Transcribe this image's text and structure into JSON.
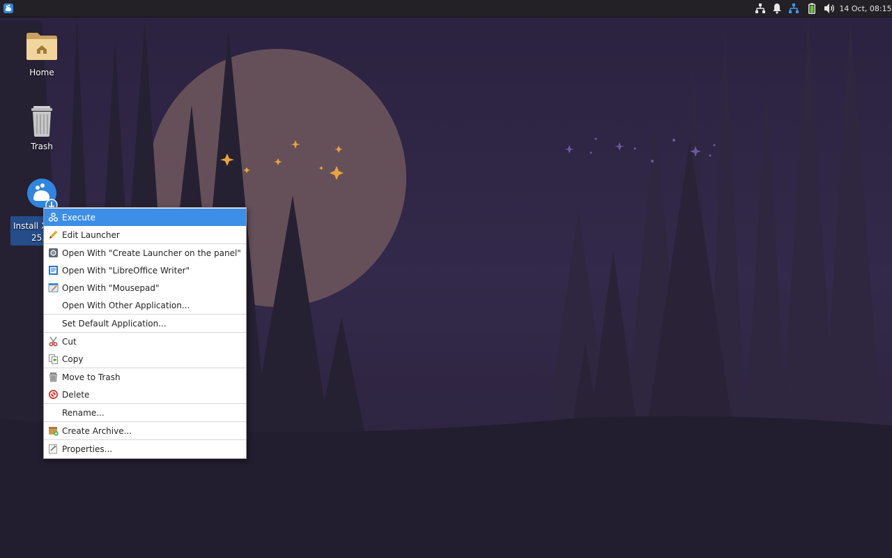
{
  "colors": {
    "panel_bg": "#232026",
    "wallpaper_bg": "#2e2440",
    "moon": "#65505a",
    "menu_highlight": "#3d8ee6",
    "selection_label": "#244d8a"
  },
  "panel": {
    "menu_icon": "xfce-mouse-icon",
    "tray_icons": [
      "network-wired-icon",
      "notification-bell-icon",
      "network-icon",
      "battery-icon",
      "volume-icon"
    ],
    "clock": "14 Oct, 08:15"
  },
  "desktop_icons": [
    {
      "label": "Home",
      "icon": "home-folder-icon"
    },
    {
      "label": "Trash",
      "icon": "trash-can-icon"
    },
    {
      "label_line1": "Install X",
      "label_line2": "25.",
      "icon": "xfce-installer-icon",
      "selected": true
    }
  ],
  "context_menu": {
    "items": [
      {
        "label": "Execute",
        "icon": "gears-icon",
        "highlighted": true
      },
      {
        "label": "Edit Launcher",
        "icon": "pencil-icon"
      },
      {
        "label": "Open With \"Create Launcher on the panel\"",
        "icon": "gear-icon"
      },
      {
        "label": "Open With \"LibreOffice Writer\"",
        "icon": "writer-doc-icon"
      },
      {
        "label": "Open With \"Mousepad\"",
        "icon": "text-editor-icon"
      },
      {
        "label": "Open With Other Application...",
        "icon": ""
      },
      {
        "label": "Set Default Application...",
        "icon": ""
      },
      {
        "label": "Cut",
        "icon": "scissors-icon"
      },
      {
        "label": "Copy",
        "icon": "copy-icon"
      },
      {
        "label": "Move to Trash",
        "icon": "trash-icon"
      },
      {
        "label": "Delete",
        "icon": "delete-icon"
      },
      {
        "label": "Rename...",
        "icon": ""
      },
      {
        "label": "Create Archive...",
        "icon": "archive-icon"
      },
      {
        "label": "Properties...",
        "icon": "properties-icon"
      }
    ]
  }
}
